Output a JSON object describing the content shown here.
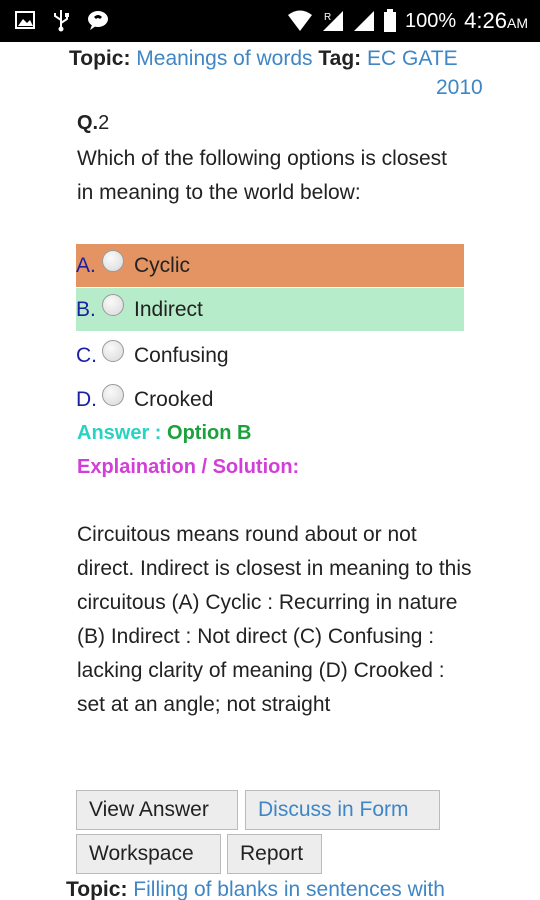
{
  "status_bar": {
    "battery": "100%",
    "time": "4:26",
    "ampm": "AM",
    "icons": [
      "image-icon",
      "usb-icon",
      "chat-icon",
      "wifi-icon",
      "signal-icon",
      "signal-icon",
      "battery-icon"
    ]
  },
  "question": {
    "topic_label": "Topic:",
    "topic": "Meanings of words",
    "tag_label": "Tag:",
    "tag": "EC GATE",
    "tag_year": "2010",
    "number_prefix": "Q.",
    "number": "2",
    "text": "Which of the following options is closest in meaning to the world below:",
    "options": [
      {
        "letter": "A.",
        "label": "Cyclic"
      },
      {
        "letter": "B.",
        "label": "Indirect"
      },
      {
        "letter": "C.",
        "label": "Confusing"
      },
      {
        "letter": "D.",
        "label": "Crooked"
      }
    ],
    "answer_label": "Answer : ",
    "answer_value": "Option B",
    "explanation_label": "Explaination / Solution:",
    "solution": "Circuitous means round about or not direct. Indirect is closest in meaning to this circuitous (A) Cyclic : Recurring in nature (B) Indirect : Not direct (C) Confusing : lacking clarity of meaning (D) Crooked : set at an angle; not straight"
  },
  "buttons": {
    "view_answer": "View Answer",
    "discuss": "Discuss in Form",
    "workspace": "Workspace",
    "report": "Report"
  },
  "next": {
    "topic_label": "Topic:",
    "topic": "Filling of blanks in sentences with"
  },
  "colors": {
    "wrong_option": "#e49463",
    "correct_option": "#b6ecc9",
    "link": "#3e86c5",
    "answer_label": "#2ad2c2",
    "answer_value": "#1aa13c",
    "explanation": "#d23fd8"
  }
}
